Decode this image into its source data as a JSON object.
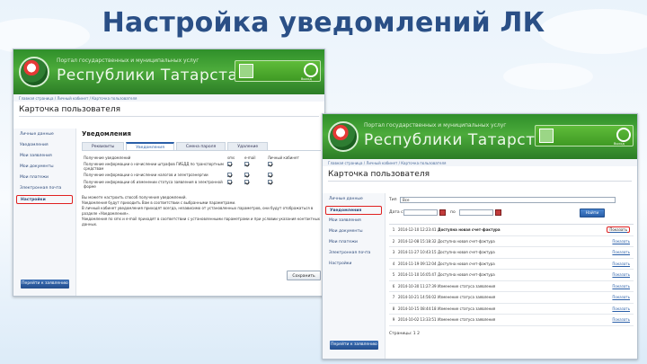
{
  "slide": {
    "title": "Настройка уведомлений ЛК"
  },
  "portal": {
    "top_text": "Портал государственных и муниципальных услуг",
    "name": "Республики Татарстан",
    "exit": "Выход"
  },
  "shot1": {
    "breadcrumb": "Главная страница / Личный кабинет / Карточка пользователя",
    "card_title": "Карточка пользователя",
    "sidebar": [
      "Личные данные",
      "Уведомления",
      "Мои заявления",
      "Мои документы",
      "Мои платежи",
      "Электронная почта",
      "Настройки"
    ],
    "sidebar_selected": 6,
    "footer_button": "Перейти к заявлению",
    "section_title": "Уведомления",
    "tabs": [
      "Реквизиты",
      "Уведомления",
      "Смена пароля",
      "Удаление"
    ],
    "active_tab": 1,
    "table_headers": [
      "Получение уведомлений",
      "sms",
      "e-mail",
      "Личный кабинет"
    ],
    "rows": [
      {
        "label": "Получение информации о начислении штрафов ГИБДД по транспортным средствам",
        "checks": [
          true,
          true,
          true
        ]
      },
      {
        "label": "Получение информации о начислении налогов и электроэнергии",
        "checks": [
          true,
          true,
          true
        ]
      },
      {
        "label": "Получение информации об изменении статуса заявления в электронной форме",
        "checks": [
          true,
          true,
          true
        ]
      }
    ],
    "note_lines": [
      "Вы можете настроить способ получения уведомлений.",
      "Уведомления будут приходить Вам в соответствии с выбранными параметрами.",
      "В личный кабинет уведомления приходят всегда, независимо от установленных параметров, они будут отображаться в разделе «Уведомления».",
      "Уведомления по sms и e-mail приходят в соответствии с установленными параметрами и при условии указания контактных данных."
    ],
    "save_button": "Сохранить"
  },
  "shot2": {
    "breadcrumb": "Главная страница / Личный кабинет / Карточка пользователя",
    "card_title": "Карточка пользователя",
    "sidebar": [
      "Личные данные",
      "Уведомления",
      "Мои заявления",
      "Мои документы",
      "Мои платежи",
      "Электронная почта",
      "Настройки"
    ],
    "sidebar_selected": 1,
    "footer_button": "Перейти к заявлению",
    "filter_type_label": "Тип",
    "filter_type_value": "Все",
    "date_from_label": "Дата с",
    "date_to_label": "по",
    "find_button": "Найти",
    "messages": [
      {
        "n": "1",
        "date": "2014-12-10 12:23:41",
        "subject": "Доступна новая счет-фактура",
        "action": "Показать",
        "bold": true,
        "highlight": true
      },
      {
        "n": "2",
        "date": "2014-12-08 15:18:32",
        "subject": "Доступна новая счет-фактура",
        "action": "Показать",
        "bold": false,
        "highlight": false
      },
      {
        "n": "3",
        "date": "2014-11-27 10:43:15",
        "subject": "Доступна новая счет-фактура",
        "action": "Показать",
        "bold": false,
        "highlight": false
      },
      {
        "n": "4",
        "date": "2014-11-19 09:12:04",
        "subject": "Доступна новая счет-фактура",
        "action": "Показать",
        "bold": false,
        "highlight": false
      },
      {
        "n": "5",
        "date": "2014-11-10 16:05:47",
        "subject": "Доступна новая счет-фактура",
        "action": "Показать",
        "bold": false,
        "highlight": false
      },
      {
        "n": "6",
        "date": "2014-10-30 11:27:39",
        "subject": "Изменение статуса заявления",
        "action": "Показать",
        "bold": false,
        "highlight": false
      },
      {
        "n": "7",
        "date": "2014-10-21 14:56:02",
        "subject": "Изменение статуса заявления",
        "action": "Показать",
        "bold": false,
        "highlight": false
      },
      {
        "n": "8",
        "date": "2014-10-15 08:44:18",
        "subject": "Изменение статуса заявления",
        "action": "Показать",
        "bold": false,
        "highlight": false
      },
      {
        "n": "9",
        "date": "2014-10-02 13:33:51",
        "subject": "Изменение статуса заявления",
        "action": "Показать",
        "bold": false,
        "highlight": false
      }
    ],
    "pagination": "Страницы: 1 2"
  }
}
